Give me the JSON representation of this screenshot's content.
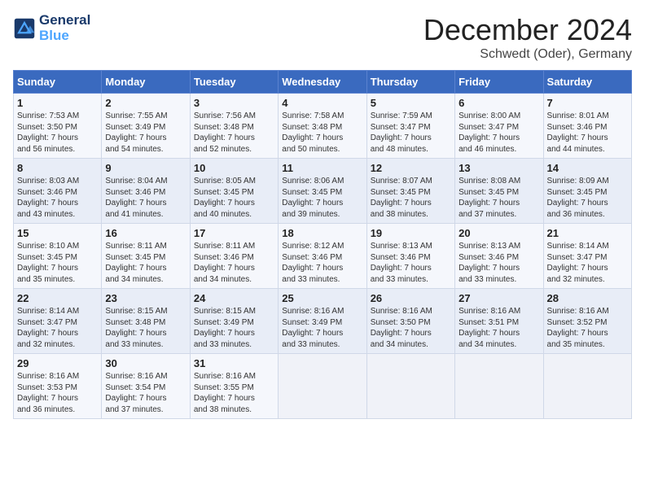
{
  "header": {
    "logo_line1": "General",
    "logo_line2": "Blue",
    "month": "December 2024",
    "location": "Schwedt (Oder), Germany"
  },
  "days_of_week": [
    "Sunday",
    "Monday",
    "Tuesday",
    "Wednesday",
    "Thursday",
    "Friday",
    "Saturday"
  ],
  "weeks": [
    [
      {
        "day": "1",
        "lines": [
          "Sunrise: 7:53 AM",
          "Sunset: 3:50 PM",
          "Daylight: 7 hours",
          "and 56 minutes."
        ]
      },
      {
        "day": "2",
        "lines": [
          "Sunrise: 7:55 AM",
          "Sunset: 3:49 PM",
          "Daylight: 7 hours",
          "and 54 minutes."
        ]
      },
      {
        "day": "3",
        "lines": [
          "Sunrise: 7:56 AM",
          "Sunset: 3:48 PM",
          "Daylight: 7 hours",
          "and 52 minutes."
        ]
      },
      {
        "day": "4",
        "lines": [
          "Sunrise: 7:58 AM",
          "Sunset: 3:48 PM",
          "Daylight: 7 hours",
          "and 50 minutes."
        ]
      },
      {
        "day": "5",
        "lines": [
          "Sunrise: 7:59 AM",
          "Sunset: 3:47 PM",
          "Daylight: 7 hours",
          "and 48 minutes."
        ]
      },
      {
        "day": "6",
        "lines": [
          "Sunrise: 8:00 AM",
          "Sunset: 3:47 PM",
          "Daylight: 7 hours",
          "and 46 minutes."
        ]
      },
      {
        "day": "7",
        "lines": [
          "Sunrise: 8:01 AM",
          "Sunset: 3:46 PM",
          "Daylight: 7 hours",
          "and 44 minutes."
        ]
      }
    ],
    [
      {
        "day": "8",
        "lines": [
          "Sunrise: 8:03 AM",
          "Sunset: 3:46 PM",
          "Daylight: 7 hours",
          "and 43 minutes."
        ]
      },
      {
        "day": "9",
        "lines": [
          "Sunrise: 8:04 AM",
          "Sunset: 3:46 PM",
          "Daylight: 7 hours",
          "and 41 minutes."
        ]
      },
      {
        "day": "10",
        "lines": [
          "Sunrise: 8:05 AM",
          "Sunset: 3:45 PM",
          "Daylight: 7 hours",
          "and 40 minutes."
        ]
      },
      {
        "day": "11",
        "lines": [
          "Sunrise: 8:06 AM",
          "Sunset: 3:45 PM",
          "Daylight: 7 hours",
          "and 39 minutes."
        ]
      },
      {
        "day": "12",
        "lines": [
          "Sunrise: 8:07 AM",
          "Sunset: 3:45 PM",
          "Daylight: 7 hours",
          "and 38 minutes."
        ]
      },
      {
        "day": "13",
        "lines": [
          "Sunrise: 8:08 AM",
          "Sunset: 3:45 PM",
          "Daylight: 7 hours",
          "and 37 minutes."
        ]
      },
      {
        "day": "14",
        "lines": [
          "Sunrise: 8:09 AM",
          "Sunset: 3:45 PM",
          "Daylight: 7 hours",
          "and 36 minutes."
        ]
      }
    ],
    [
      {
        "day": "15",
        "lines": [
          "Sunrise: 8:10 AM",
          "Sunset: 3:45 PM",
          "Daylight: 7 hours",
          "and 35 minutes."
        ]
      },
      {
        "day": "16",
        "lines": [
          "Sunrise: 8:11 AM",
          "Sunset: 3:45 PM",
          "Daylight: 7 hours",
          "and 34 minutes."
        ]
      },
      {
        "day": "17",
        "lines": [
          "Sunrise: 8:11 AM",
          "Sunset: 3:46 PM",
          "Daylight: 7 hours",
          "and 34 minutes."
        ]
      },
      {
        "day": "18",
        "lines": [
          "Sunrise: 8:12 AM",
          "Sunset: 3:46 PM",
          "Daylight: 7 hours",
          "and 33 minutes."
        ]
      },
      {
        "day": "19",
        "lines": [
          "Sunrise: 8:13 AM",
          "Sunset: 3:46 PM",
          "Daylight: 7 hours",
          "and 33 minutes."
        ]
      },
      {
        "day": "20",
        "lines": [
          "Sunrise: 8:13 AM",
          "Sunset: 3:46 PM",
          "Daylight: 7 hours",
          "and 33 minutes."
        ]
      },
      {
        "day": "21",
        "lines": [
          "Sunrise: 8:14 AM",
          "Sunset: 3:47 PM",
          "Daylight: 7 hours",
          "and 32 minutes."
        ]
      }
    ],
    [
      {
        "day": "22",
        "lines": [
          "Sunrise: 8:14 AM",
          "Sunset: 3:47 PM",
          "Daylight: 7 hours",
          "and 32 minutes."
        ]
      },
      {
        "day": "23",
        "lines": [
          "Sunrise: 8:15 AM",
          "Sunset: 3:48 PM",
          "Daylight: 7 hours",
          "and 33 minutes."
        ]
      },
      {
        "day": "24",
        "lines": [
          "Sunrise: 8:15 AM",
          "Sunset: 3:49 PM",
          "Daylight: 7 hours",
          "and 33 minutes."
        ]
      },
      {
        "day": "25",
        "lines": [
          "Sunrise: 8:16 AM",
          "Sunset: 3:49 PM",
          "Daylight: 7 hours",
          "and 33 minutes."
        ]
      },
      {
        "day": "26",
        "lines": [
          "Sunrise: 8:16 AM",
          "Sunset: 3:50 PM",
          "Daylight: 7 hours",
          "and 34 minutes."
        ]
      },
      {
        "day": "27",
        "lines": [
          "Sunrise: 8:16 AM",
          "Sunset: 3:51 PM",
          "Daylight: 7 hours",
          "and 34 minutes."
        ]
      },
      {
        "day": "28",
        "lines": [
          "Sunrise: 8:16 AM",
          "Sunset: 3:52 PM",
          "Daylight: 7 hours",
          "and 35 minutes."
        ]
      }
    ],
    [
      {
        "day": "29",
        "lines": [
          "Sunrise: 8:16 AM",
          "Sunset: 3:53 PM",
          "Daylight: 7 hours",
          "and 36 minutes."
        ]
      },
      {
        "day": "30",
        "lines": [
          "Sunrise: 8:16 AM",
          "Sunset: 3:54 PM",
          "Daylight: 7 hours",
          "and 37 minutes."
        ]
      },
      {
        "day": "31",
        "lines": [
          "Sunrise: 8:16 AM",
          "Sunset: 3:55 PM",
          "Daylight: 7 hours",
          "and 38 minutes."
        ]
      },
      null,
      null,
      null,
      null
    ]
  ]
}
